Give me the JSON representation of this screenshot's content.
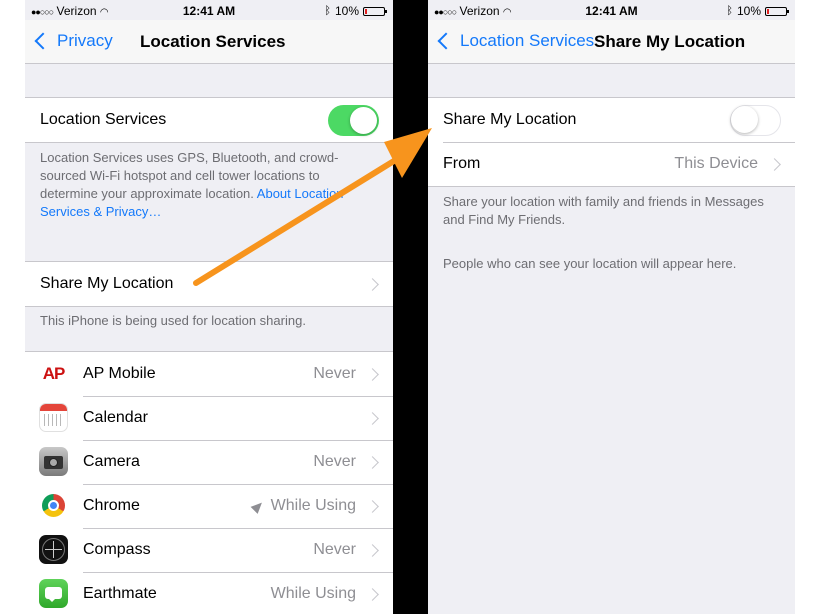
{
  "left": {
    "status": {
      "carrier": "Verizon",
      "time": "12:41 AM",
      "battery": "10%",
      "battery_level": 0.1
    },
    "nav": {
      "back": "Privacy",
      "title": "Location Services"
    },
    "location_services": {
      "label": "Location Services",
      "toggle": "on"
    },
    "description": {
      "text": "Location Services uses GPS, Bluetooth, and crowd-sourced Wi-Fi hotspot and cell tower locations to determine your approximate location. ",
      "link": "About Location Services & Privacy…"
    },
    "share_row": {
      "label": "Share My Location"
    },
    "share_note": "This iPhone is being used for location sharing.",
    "apps": [
      {
        "label": "AP Mobile",
        "value": "Never",
        "icon": "ap-mobile-icon",
        "icon_text": "AP"
      },
      {
        "label": "Calendar",
        "value": "",
        "icon": "calendar-icon"
      },
      {
        "label": "Camera",
        "value": "Never",
        "icon": "camera-icon"
      },
      {
        "label": "Chrome",
        "value": "While Using",
        "icon": "chrome-icon",
        "indicator": "location-arrow-icon"
      },
      {
        "label": "Compass",
        "value": "Never",
        "icon": "compass-icon"
      },
      {
        "label": "Earthmate",
        "value": "While Using",
        "icon": "earthmate-icon"
      }
    ]
  },
  "right": {
    "status": {
      "carrier": "Verizon",
      "time": "12:41 AM",
      "battery": "10%",
      "battery_level": 0.1
    },
    "nav": {
      "back": "Location Services",
      "title": "Share My Location"
    },
    "share": {
      "label": "Share My Location",
      "toggle": "off"
    },
    "from": {
      "label": "From",
      "value": "This Device"
    },
    "note1": "Share your location with family and friends in Messages and Find My Friends.",
    "note2": "People who can see your location will appear here."
  },
  "colors": {
    "accent": "#1479fa",
    "toggle_on": "#4cd964",
    "annotation_arrow": "#f7941d",
    "battery_low": "#e02020"
  }
}
